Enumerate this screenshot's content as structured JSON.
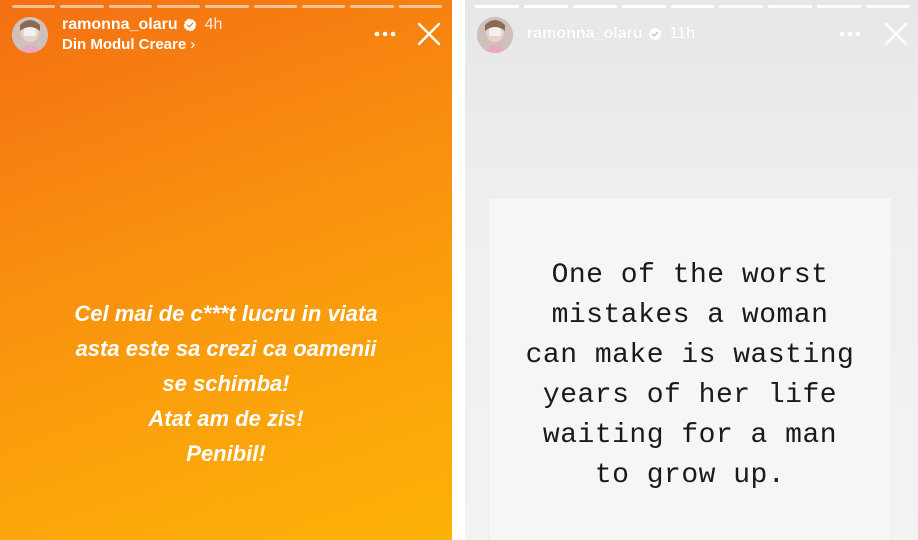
{
  "left_story": {
    "progress_segments": 9,
    "username": "ramonna_olaru",
    "time_ago": "4h",
    "subtitle": "Din Modul Creare",
    "subtitle_icon": "chevron-right-icon",
    "caption_lines": [
      "Cel mai de c***t lucru in viata",
      "asta este sa crezi ca oamenii",
      "se schimba!",
      "Atat am de zis!",
      "Penibil!"
    ],
    "background_colors": [
      "#f46f12",
      "#fcb206"
    ]
  },
  "right_story": {
    "progress_segments": 9,
    "username": "ramonna_olaru",
    "time_ago": "11h",
    "quote_lines": [
      "One of the worst",
      "mistakes a woman",
      "can make is wasting",
      "years of her life",
      "waiting for a man",
      "to grow up."
    ],
    "background_color": "#efefef",
    "card_color": "#f6f6f4"
  },
  "icons": {
    "verified": "verified-badge-icon",
    "more": "more-options-icon",
    "close": "close-icon"
  },
  "colors": {
    "verified_badge": "#ffffff"
  }
}
